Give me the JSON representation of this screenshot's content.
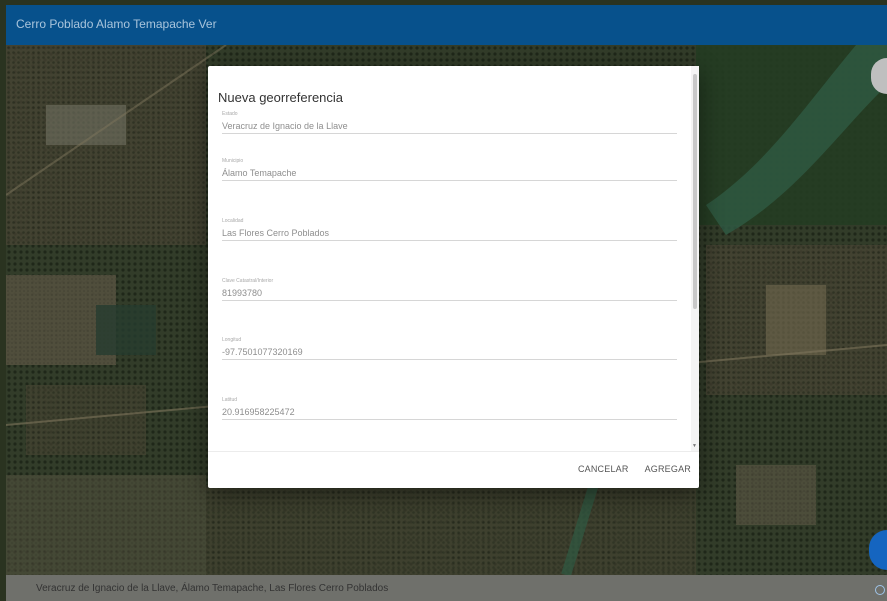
{
  "appbar": {
    "title": "Cerro Poblado Alamo Temapache Ver",
    "color": "#07518c"
  },
  "dialog": {
    "title": "Nueva georreferencia",
    "fields": [
      {
        "label": "Estado",
        "value": "Veracruz de Ignacio de la Llave"
      },
      {
        "label": "Municipio",
        "value": "Álamo Temapache"
      },
      {
        "label": "Localidad",
        "value": "Las Flores Cerro Poblados"
      },
      {
        "label": "Clave Catastral/Interior",
        "value": "81993780"
      },
      {
        "label": "Longitud",
        "value": "-97.7501077320169"
      },
      {
        "label": "Latitud",
        "value": "20.916958225472"
      }
    ],
    "cancel_label": "CANCELAR",
    "add_label": "AGREGAR"
  },
  "bottombar": {
    "text": "Veracruz de Ignacio de la Llave, Álamo Temapache, Las Flores Cerro Poblados"
  },
  "colors": {
    "accent": "#1565c0",
    "appbar": "#07518c",
    "dialog": "#ffffff"
  },
  "icons": {
    "fab": "fab-circle",
    "corner": "map-control-button",
    "help": "info-icon"
  }
}
